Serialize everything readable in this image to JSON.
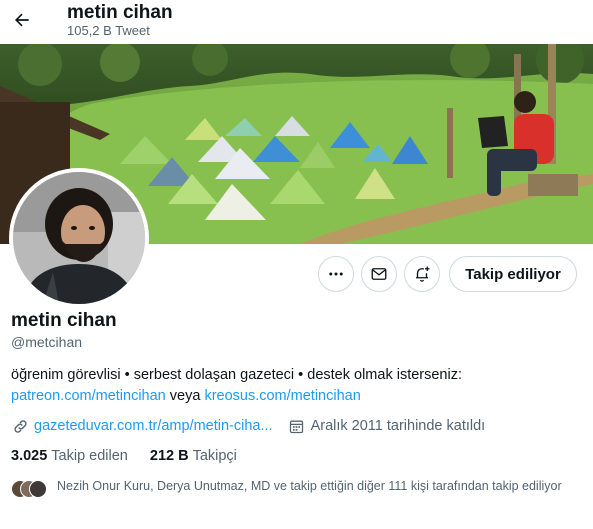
{
  "header": {
    "title": "metin cihan",
    "tweet_count": "105,2 B Tweet"
  },
  "profile": {
    "display_name": "metin cihan",
    "handle": "@metcihan",
    "bio_line1": "öğrenim görevlisi • serbest dolaşan gazeteci • destek olmak isterseniz:",
    "bio_link1": "patreon.com/metincihan",
    "bio_connector": " veya ",
    "bio_link2": "kreosus.com/metincihan",
    "website": "gazeteduvar.com.tr/amp/metin-ciha...",
    "joined": "Aralık 2011 tarihinde katıldı",
    "following_count": "3.025",
    "following_label": "Takip edilen",
    "followers_count": "212 B",
    "followers_label": "Takipçi",
    "followers_you_know": "Nezih Onur Kuru, Derya Unutmaz, MD ve takip ettiğin diğer 111 kişi tarafından takip ediliyor"
  },
  "actions": {
    "follow_label": "Takip ediliyor"
  },
  "icons": {
    "back": "arrow-left-icon",
    "more": "more-icon",
    "message": "envelope-icon",
    "notify": "bell-plus-icon",
    "link": "link-icon",
    "calendar": "calendar-icon"
  },
  "colors": {
    "accent": "#1d9bf0",
    "text_primary": "#0f1419",
    "text_secondary": "#536471",
    "border": "#cfd9de"
  }
}
